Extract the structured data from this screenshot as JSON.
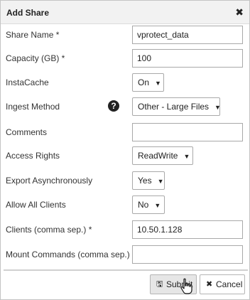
{
  "dialog": {
    "title": "Add Share",
    "close_symbol": "✖"
  },
  "fields": {
    "share_name": {
      "label": "Share Name *",
      "value": "vprotect_data"
    },
    "capacity": {
      "label": "Capacity (GB) *",
      "value": "100"
    },
    "instacache": {
      "label": "InstaCache",
      "value": "On"
    },
    "ingest_method": {
      "label": "Ingest Method",
      "value": "Other - Large Files",
      "help_icon": "question-circle-icon",
      "help_symbol": "?"
    },
    "comments": {
      "label": "Comments",
      "value": ""
    },
    "access_rights": {
      "label": "Access Rights",
      "value": "ReadWrite"
    },
    "export_async": {
      "label": "Export Asynchronously",
      "value": "Yes"
    },
    "allow_all_clients": {
      "label": "Allow All Clients",
      "value": "No"
    },
    "clients": {
      "label": "Clients (comma sep.) *",
      "value": "10.50.1.128"
    },
    "mount_commands": {
      "label": "Mount Commands (comma sep.)",
      "value": ""
    }
  },
  "buttons": {
    "submit": {
      "label": "Submit",
      "icon": "floppy-disk-icon",
      "symbol": "🖫"
    },
    "cancel": {
      "label": "Cancel",
      "icon": "times-icon",
      "symbol": "✖"
    }
  },
  "select_caret": "▼",
  "icons": {
    "cursor": "hand-pointer-cursor-icon"
  },
  "colors": {
    "header_bg": "#f2f2f2",
    "submit_bg": "#e6e6e6",
    "border": "#a9a9a9"
  }
}
